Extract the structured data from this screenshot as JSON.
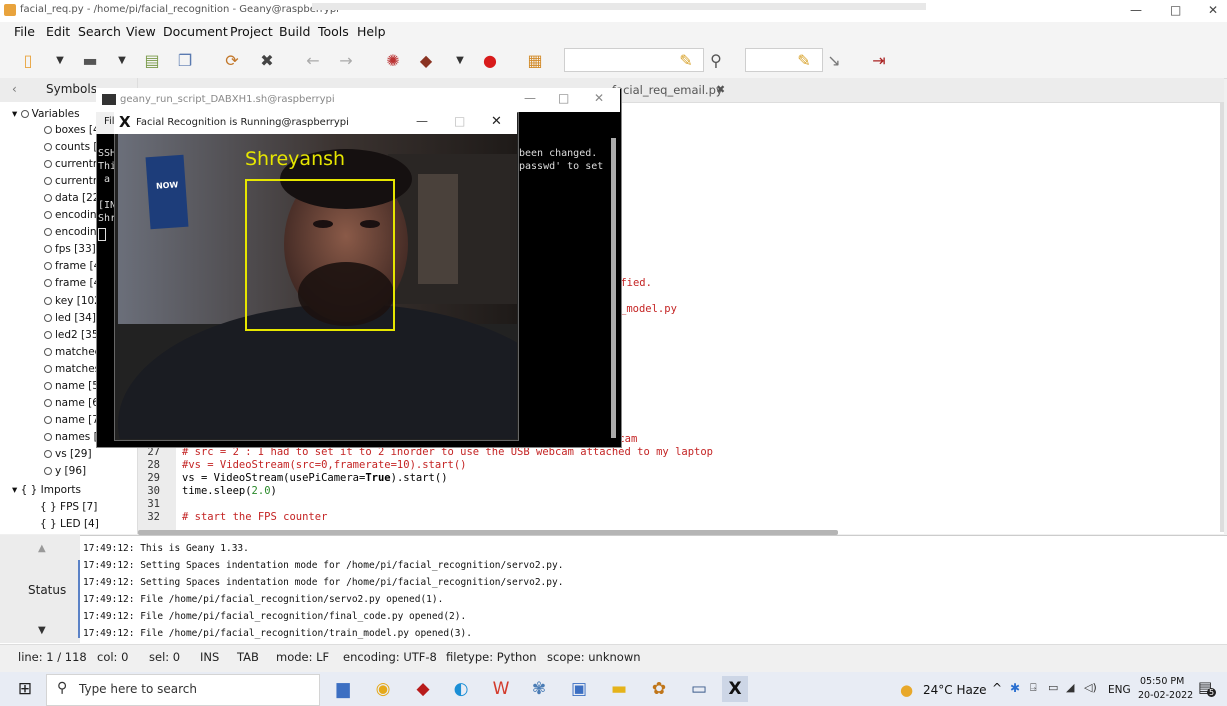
{
  "window": {
    "title": "facial_req.py - /home/pi/facial_recognition - Geany@raspberrypi",
    "minimize": "—",
    "maximize": "□",
    "close": "✕"
  },
  "menu": [
    "File",
    "Edit",
    "Search",
    "View",
    "Document",
    "Project",
    "Build",
    "Tools",
    "Help"
  ],
  "sidebar": {
    "tab_label": "Symbols",
    "variables_header": "Variables",
    "variables": [
      "boxes [4",
      "counts [6",
      "currentn",
      "currentn",
      "data [22]",
      "encoding",
      "encoding",
      "fps [33]",
      "frame [4",
      "frame [4",
      "key [102",
      "led [34]",
      "led2 [35]",
      "matched",
      "matches",
      "name [5",
      "name [6",
      "name [7",
      "names [4",
      "vs [29]",
      "y [96]"
    ],
    "imports_header": "Imports",
    "imports": [
      "FPS [7]",
      "LED [4]"
    ]
  },
  "editor": {
    "tab2": "facial_req_email.py",
    "tab2_close": "✖",
    "right_lines": [
      {
        "text": "ified."
      },
      {
        "text": "_model.py"
      },
      {
        "text": "bcam"
      }
    ],
    "lines": [
      {
        "no": "27",
        "text": "# src = 2 : I had to set it to 2 inorder to use the USB webcam attached to my laptop"
      },
      {
        "no": "28",
        "text": "#vs = VideoStream(src=0,framerate=10).start()"
      },
      {
        "no": "29",
        "text_a": "vs = VideoStream(usePiCamera=",
        "kw": "True",
        "text_b": ").start()"
      },
      {
        "no": "30",
        "text_a": "time.sleep(",
        "num": "2.0",
        "text_b": ")"
      },
      {
        "no": "31",
        "text": ""
      },
      {
        "no": "32",
        "text": "# start the FPS counter"
      }
    ]
  },
  "terminal": {
    "title": "geany_run_script_DABXH1.sh@raspberrypi",
    "left_lines": [
      "SSH",
      "Thi",
      "a",
      "",
      "[IN",
      "Shr"
    ],
    "right_lines": [
      "been changed.",
      "passwd' to set"
    ],
    "menu_stub": "Fil"
  },
  "face_window": {
    "title": "Facial Recognition is Running@raspberrypi",
    "label": "Shreyansh",
    "poster": "NOW"
  },
  "status_panel": {
    "label": "Status",
    "messages": [
      "17:49:12: This is Geany 1.33.",
      "17:49:12: Setting Spaces indentation mode for /home/pi/facial_recognition/servo2.py.",
      "17:49:12: Setting Spaces indentation mode for /home/pi/facial_recognition/servo2.py.",
      "17:49:12: File /home/pi/facial_recognition/servo2.py opened(1).",
      "17:49:12: File /home/pi/facial_recognition/final_code.py opened(2).",
      "17:49:12: File /home/pi/facial_recognition/train_model.py opened(3)."
    ]
  },
  "statusbar": {
    "line": "line: 1 / 118",
    "col": "col: 0",
    "sel": "sel: 0",
    "ins": "INS",
    "tab": "TAB",
    "mode": "mode: LF",
    "encoding": "encoding: UTF-8",
    "filetype": "filetype: Python",
    "scope": "scope: unknown"
  },
  "taskbar": {
    "search_placeholder": "Type here to search",
    "weather": "24°C  Haze",
    "lang": "ENG",
    "time": "05:50 PM",
    "date": "20-02-2022",
    "notif_count": "5"
  },
  "colors": {
    "accent": "#c42424",
    "face_box": "#e6e600",
    "taskbar": "#e8ecf4"
  }
}
